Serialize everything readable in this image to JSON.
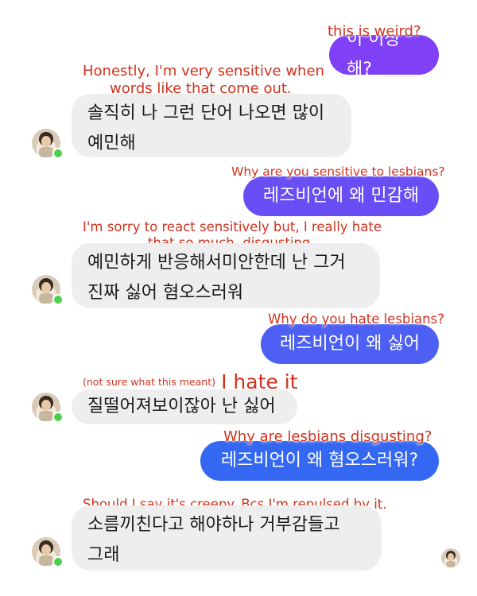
{
  "messages": [
    {
      "id": "m1",
      "direction": "outgoing",
      "text": "이 이상해?",
      "translation": "this is weird?"
    },
    {
      "id": "m2",
      "direction": "incoming",
      "text_lines": [
        "솔직히 나 그런 단어 나오면 많이",
        "예민해"
      ],
      "translation_lines": [
        "Honestly, I'm very sensitive when",
        "words like that come out."
      ]
    },
    {
      "id": "m3",
      "direction": "outgoing",
      "text": "레즈비언에 왜 민감해",
      "translation": "Why are you sensitive to lesbians?"
    },
    {
      "id": "m4",
      "direction": "incoming",
      "text_lines": [
        "예민하게 반응해서미안한데 난 그거",
        "진짜 싫어 혐오스러워"
      ],
      "translation_lines": [
        "I'm sorry to react sensitively but, I really hate",
        "that so much. disgusting."
      ]
    },
    {
      "id": "m5",
      "direction": "outgoing",
      "text": "레즈비언이 왜 싫어",
      "translation": "Why do you hate lesbians?"
    },
    {
      "id": "m6",
      "direction": "incoming",
      "text_lines": [
        "질떨어져보이잖아 난 싫어"
      ],
      "translation_note": "(not sure what this meant)",
      "translation_big": "I hate it"
    },
    {
      "id": "m7",
      "direction": "outgoing",
      "text": "레즈비언이 왜 혐오스러워?",
      "translation": "Why are lesbians disgusting?"
    },
    {
      "id": "m8",
      "direction": "incoming",
      "text_lines": [
        "소름끼친다고 해야하나 거부감들고",
        "그래"
      ],
      "translation_lines": [
        "Should I say it's creepy. Bcs I'm repulsed by it."
      ]
    }
  ],
  "colors": {
    "outgoing_bubble_top": "#8a3ff5",
    "outgoing_bubble_bottom": "#2f6bf2",
    "incoming_bubble": "#eeeeef",
    "translation_text": "#d0321e",
    "online_indicator": "#4cd14c"
  },
  "icons": {
    "avatar": "profile-photo-avatar",
    "online": "online-status-dot",
    "seen": "seen-receipt-avatar"
  }
}
